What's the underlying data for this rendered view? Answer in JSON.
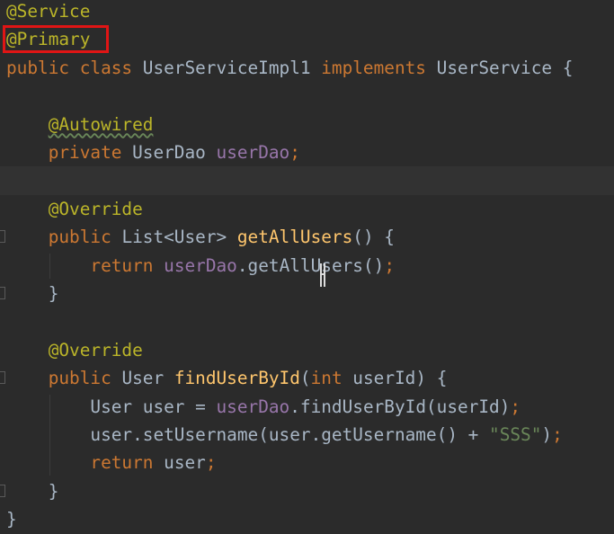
{
  "editor": {
    "lines": [
      {
        "segments": [
          {
            "t": "@Service",
            "c": "annot"
          }
        ]
      },
      {
        "segments": [
          {
            "t": "@Primary",
            "c": "annot"
          }
        ]
      },
      {
        "segments": [
          {
            "t": "public class ",
            "c": "kw"
          },
          {
            "t": "UserServiceImpl1 ",
            "c": ""
          },
          {
            "t": "implements ",
            "c": "kw"
          },
          {
            "t": "UserService {",
            "c": ""
          }
        ]
      },
      {
        "segments": []
      },
      {
        "segments": [
          {
            "t": "    ",
            "c": ""
          },
          {
            "t": "@Autowired",
            "c": "annot squiggle"
          }
        ]
      },
      {
        "segments": [
          {
            "t": "    ",
            "c": ""
          },
          {
            "t": "private ",
            "c": "kw"
          },
          {
            "t": "UserDao ",
            "c": ""
          },
          {
            "t": "userDao",
            "c": "field"
          },
          {
            "t": ";",
            "c": "kw"
          }
        ]
      },
      {
        "segments": [],
        "current": true
      },
      {
        "segments": [
          {
            "t": "    ",
            "c": ""
          },
          {
            "t": "@Override",
            "c": "annot"
          }
        ]
      },
      {
        "segments": [
          {
            "t": "    ",
            "c": ""
          },
          {
            "t": "public ",
            "c": "kw"
          },
          {
            "t": "List<User> ",
            "c": ""
          },
          {
            "t": "getAllUsers",
            "c": "method"
          },
          {
            "t": "() {",
            "c": ""
          }
        ],
        "gutter": true
      },
      {
        "segments": [
          {
            "t": "        ",
            "c": ""
          },
          {
            "t": "return ",
            "c": "kw"
          },
          {
            "t": "userDao",
            "c": "field"
          },
          {
            "t": ".getAllUsers()",
            "c": ""
          },
          {
            "t": ";",
            "c": "kw"
          }
        ]
      },
      {
        "segments": [
          {
            "t": "    }",
            "c": ""
          }
        ],
        "gutter": true
      },
      {
        "segments": []
      },
      {
        "segments": [
          {
            "t": "    ",
            "c": ""
          },
          {
            "t": "@Override",
            "c": "annot"
          }
        ]
      },
      {
        "segments": [
          {
            "t": "    ",
            "c": ""
          },
          {
            "t": "public ",
            "c": "kw"
          },
          {
            "t": "User ",
            "c": ""
          },
          {
            "t": "findUserById",
            "c": "method"
          },
          {
            "t": "(",
            "c": ""
          },
          {
            "t": "int ",
            "c": "kw"
          },
          {
            "t": "userId) {",
            "c": ""
          }
        ],
        "gutter": true
      },
      {
        "segments": [
          {
            "t": "        ",
            "c": ""
          },
          {
            "t": "User user = ",
            "c": ""
          },
          {
            "t": "userDao",
            "c": "field"
          },
          {
            "t": ".findUserById(userId)",
            "c": ""
          },
          {
            "t": ";",
            "c": "kw"
          }
        ]
      },
      {
        "segments": [
          {
            "t": "        ",
            "c": ""
          },
          {
            "t": "user.setUsername(user.getUsername() + ",
            "c": ""
          },
          {
            "t": "\"SSS\"",
            "c": "str"
          },
          {
            "t": ")",
            "c": ""
          },
          {
            "t": ";",
            "c": "kw"
          }
        ]
      },
      {
        "segments": [
          {
            "t": "        ",
            "c": ""
          },
          {
            "t": "return ",
            "c": "kw"
          },
          {
            "t": "user",
            "c": ""
          },
          {
            "t": ";",
            "c": "kw"
          }
        ]
      },
      {
        "segments": [
          {
            "t": "    }",
            "c": ""
          }
        ],
        "gutter": true
      },
      {
        "segments": [
          {
            "t": "}",
            "c": ""
          }
        ]
      }
    ]
  },
  "colors": {
    "background": "#2b2b2b",
    "current_line": "#323232",
    "annotation": "#bbb529",
    "keyword": "#cc7832",
    "field": "#9876aa",
    "method": "#ffc66d",
    "string": "#6a8759",
    "text": "#a9b7c6",
    "highlight_box": "#e01515"
  },
  "highlight": {
    "target": "@Primary"
  }
}
